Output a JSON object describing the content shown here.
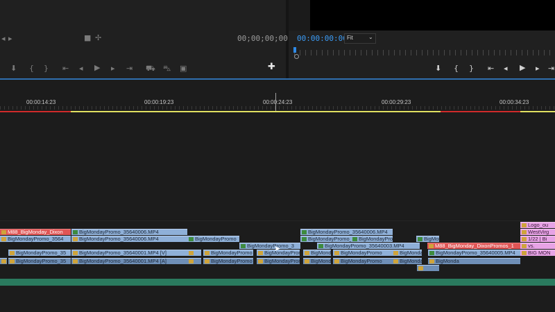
{
  "source_monitor": {
    "timecode": "00;00;00;00"
  },
  "program_monitor": {
    "timecode": "00:00:00:00",
    "zoom": "Fit"
  },
  "ruler": {
    "ticks": [
      "00:00:14:23",
      "00:00:19:23",
      "00:00:24:23",
      "00:00:29:23",
      "00:00:34:23"
    ]
  },
  "clips": {
    "c1": "M88_BigMonday_Dixon",
    "c2": "BigMondayPromo_35640006.MP4",
    "c3": "BigMondayPromo_35640006.MP4",
    "c4": "BigMondayPromo_35640006.MP4",
    "c5": "BigMondayPromo_3564",
    "c6": "BigMondayPromo_35640006.MP4",
    "c7": "BigMondayPromo",
    "c8": "BigMonday",
    "c9": "BigMondayPromo_35640003.MP4",
    "c10": "BigMondayPromo_3",
    "c11": "BigMondayPromo_35",
    "c12": "BigMondayPromo_35640001.MP4 [V]",
    "c13": "BigMondayPromo",
    "c14": "BigMondayPromo",
    "c15": "BigMondayPromo_35640005.MP4",
    "c16": "M88_BigMonday_DixonPromos_1",
    "c17": "BigMondayPromo_35",
    "c18": "BigMondayPromo_35640001.MP4 [A]",
    "c19": "BigMonda",
    "c20": "Logo_ou",
    "c21": "WestVirg",
    "c22": "1/22 | Bi",
    "c23": "vs.",
    "c24": "BIG MON"
  },
  "colors": {
    "accent_blue": "#2f8ae6",
    "timeline_green": "#2a7a5e",
    "work_area_yellow": "#e0e060",
    "render_red": "#d02a2a"
  }
}
